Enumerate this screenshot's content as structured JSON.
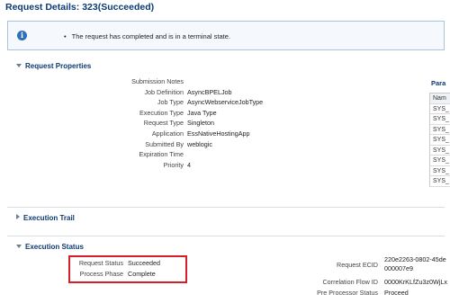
{
  "page": {
    "title": "Request Details: 323(Succeeded)"
  },
  "info": {
    "message": "The request has completed and is in a terminal state."
  },
  "sections": {
    "request_properties": "Request Properties",
    "execution_trail": "Execution Trail",
    "execution_status": "Execution Status"
  },
  "properties": [
    {
      "label": "Submission Notes",
      "value": ""
    },
    {
      "label": "Job Definition",
      "value": "AsyncBPELJob"
    },
    {
      "label": "Job Type",
      "value": "AsyncWebserviceJobType"
    },
    {
      "label": "Execution Type",
      "value": "Java Type"
    },
    {
      "label": "Request Type",
      "value": "Singleton"
    },
    {
      "label": "Application",
      "value": "EssNativeHostingApp"
    },
    {
      "label": "Submitted By",
      "value": "weblogic"
    },
    {
      "label": "Expiration Time",
      "value": ""
    },
    {
      "label": "Priority",
      "value": "4"
    }
  ],
  "parameters": {
    "label": "Para",
    "header": "Nam",
    "rows": [
      "SYS_",
      "SYS_",
      "SYS_",
      "SYS_",
      "SYS_",
      "SYS_",
      "SYS_",
      "SYS_"
    ]
  },
  "status": {
    "request_status_label": "Request Status",
    "request_status_value": "Succeeded",
    "process_phase_label": "Process Phase",
    "process_phase_value": "Complete"
  },
  "ids": {
    "request_ecid_label": "Request ECID",
    "request_ecid_value_1": "220e2263-0802-45de",
    "request_ecid_value_2": "000007e9",
    "correlation_label": "Correlation Flow ID",
    "correlation_value": "0000KrKLfZu3z0WjLx",
    "preprocessor_label": "Pre Processor Status",
    "preprocessor_value": "Proceed"
  }
}
